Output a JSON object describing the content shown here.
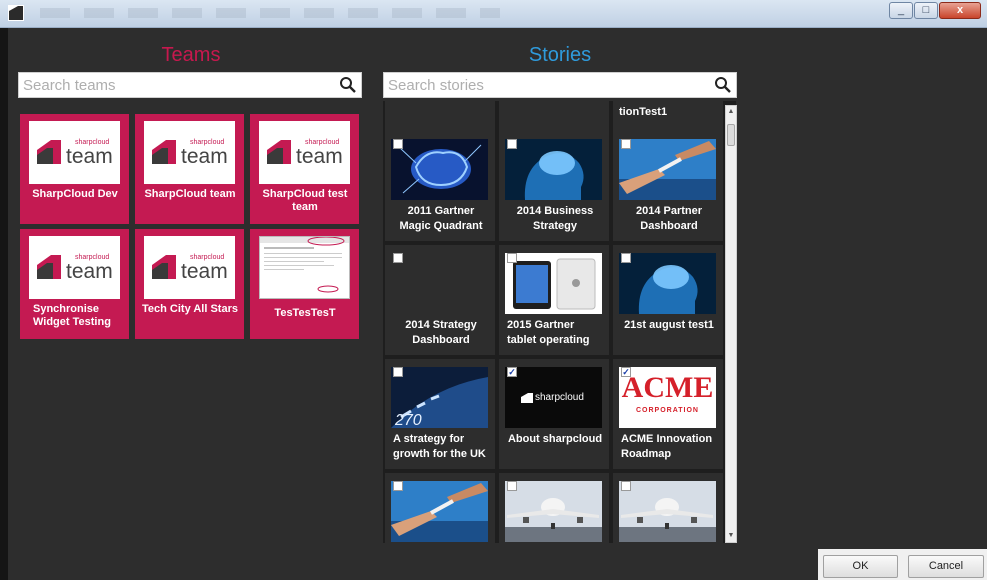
{
  "window": {
    "close_glyph": "x",
    "minimize_glyph": "_",
    "maximize_glyph": "□"
  },
  "teams": {
    "heading": "Teams",
    "search_placeholder": "Search teams",
    "brand_small": "sharpcloud",
    "brand_word": "team",
    "items": [
      {
        "label": "SharpCloud Dev"
      },
      {
        "label": "SharpCloud team"
      },
      {
        "label": "SharpCloud test team"
      },
      {
        "label": "Synchronise Widget Testing"
      },
      {
        "label": "Tech City All Stars"
      },
      {
        "label": "TesTesTesT"
      }
    ]
  },
  "stories": {
    "heading": "Stories",
    "search_placeholder": "Search stories",
    "partial_top_label": "tionTest1",
    "items": [
      {
        "label": "2011 Gartner Magic Quadrant",
        "thumb": "brain-icon",
        "checked": false
      },
      {
        "label": "2014 Business Strategy",
        "thumb": "brain-icon",
        "checked": false
      },
      {
        "label": "2014 Partner Dashboard",
        "thumb": "baton-pass-icon",
        "checked": false
      },
      {
        "label": "2014 Strategy Dashboard",
        "thumb": "blank",
        "checked": false
      },
      {
        "label": "2015 Gartner tablet operating",
        "thumb": "tablet-icon",
        "checked": false
      },
      {
        "label": "21st august test1",
        "thumb": "brain-icon",
        "checked": false
      },
      {
        "label": "A strategy for growth for the UK",
        "thumb": "speedometer-icon",
        "checked": false
      },
      {
        "label": "About sharpcloud",
        "thumb": "sharpcloud-logo",
        "checked": true,
        "logo_text": "sharpcloud"
      },
      {
        "label": "ACME Innovation Roadmap",
        "thumb": "acme-logo",
        "checked": true,
        "logo_text": "ACME",
        "logo_sub": "CORPORATION"
      },
      {
        "label": "",
        "thumb": "baton-pass-icon",
        "checked": false
      },
      {
        "label": "",
        "thumb": "airplane-icon",
        "checked": false
      },
      {
        "label": "",
        "thumb": "airplane-icon",
        "checked": false
      }
    ]
  },
  "dialog": {
    "ok_label": "OK",
    "cancel_label": "Cancel"
  },
  "colors": {
    "teams_accent": "#c41a52",
    "stories_accent": "#2f9bdc",
    "background": "#2d2d2d"
  }
}
